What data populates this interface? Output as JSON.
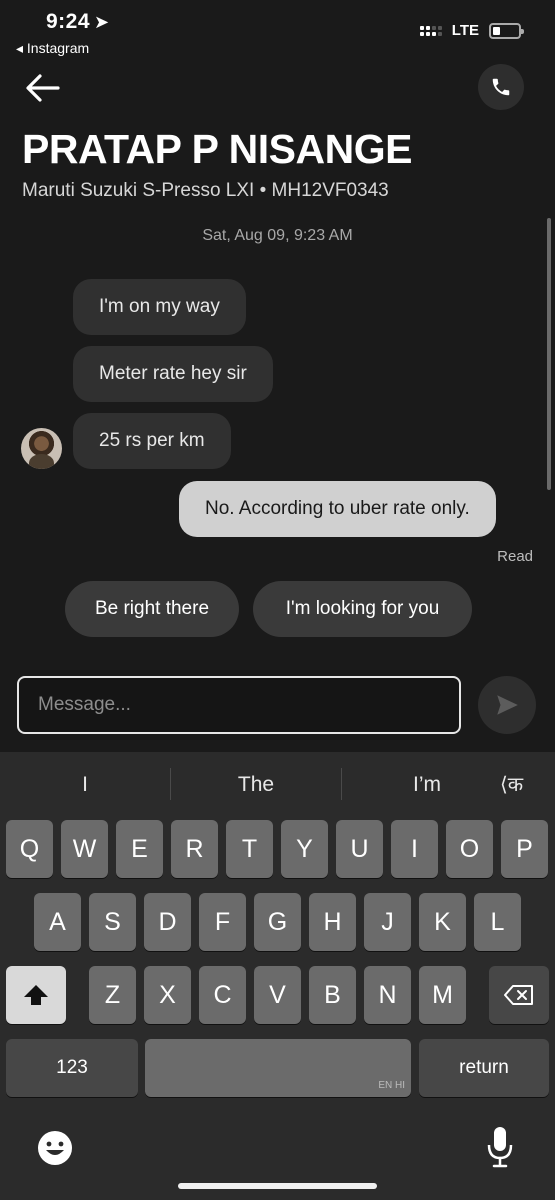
{
  "status": {
    "time": "9:24",
    "back_app": "◂ Instagram",
    "network": "LTE"
  },
  "header": {
    "driver_name": "PRATAP P NISANGE",
    "vehicle": "Maruti Suzuki S-Presso LXI • MH12VF0343"
  },
  "chat": {
    "timestamp": "Sat, Aug 09, 9:23 AM",
    "messages": [
      {
        "text": "I'm on my way",
        "from": "driver"
      },
      {
        "text": "Meter rate hey sir",
        "from": "driver"
      },
      {
        "text": "25 rs per km",
        "from": "driver"
      },
      {
        "text": "No.  According to uber rate only.",
        "from": "me"
      }
    ],
    "read_receipt": "Read"
  },
  "quick_replies": [
    "Be right there",
    "I'm looking for you"
  ],
  "composer": {
    "placeholder": "Message..."
  },
  "keyboard": {
    "suggestions": [
      "I",
      "The",
      "I’m"
    ],
    "lang_switch": "⟨क",
    "row1": [
      "Q",
      "W",
      "E",
      "R",
      "T",
      "Y",
      "U",
      "I",
      "O",
      "P"
    ],
    "row2": [
      "A",
      "S",
      "D",
      "F",
      "G",
      "H",
      "J",
      "K",
      "L"
    ],
    "row3": [
      "Z",
      "X",
      "C",
      "V",
      "B",
      "N",
      "M"
    ],
    "numbers": "123",
    "space_langs": "EN HI",
    "return": "return"
  },
  "colors": {
    "background": "#1a1a1a",
    "bubble_in": "#303030",
    "bubble_out": "#d0d0d0",
    "keyboard": "#2b2b2b"
  }
}
